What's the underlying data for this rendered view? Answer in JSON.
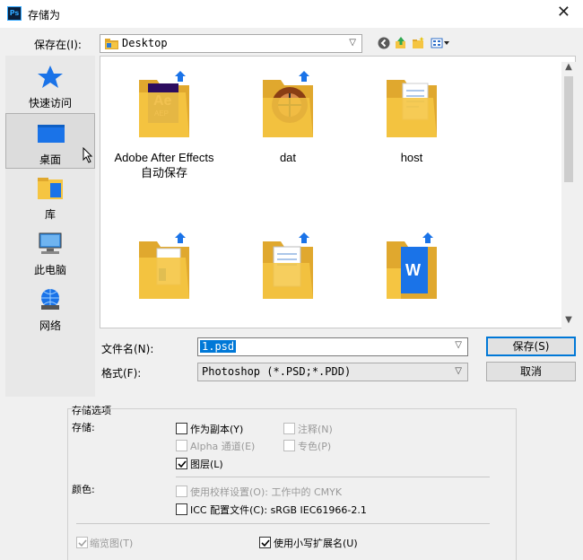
{
  "window": {
    "title": "存储为",
    "close": "✕",
    "app_icon": "Ps"
  },
  "location": {
    "label": "保存在(I):",
    "value": "Desktop"
  },
  "toolbar": {
    "icons": [
      "back-icon",
      "up-folder-icon",
      "new-folder-icon",
      "view-menu-icon"
    ]
  },
  "places": [
    {
      "label": "快速访问",
      "icon": "star-icon"
    },
    {
      "label": "桌面",
      "icon": "desktop-icon",
      "selected": true
    },
    {
      "label": "库",
      "icon": "library-icon"
    },
    {
      "label": "此电脑",
      "icon": "computer-icon"
    },
    {
      "label": "网络",
      "icon": "network-icon"
    }
  ],
  "files": [
    {
      "name": "Adobe After Effects\n自动保存",
      "icon": "ae-folder"
    },
    {
      "name": "dat",
      "icon": "dat-folder"
    },
    {
      "name": "host",
      "icon": "doc-folder"
    },
    {
      "name": "",
      "icon": "plain-folder"
    },
    {
      "name": "",
      "icon": "doc-folder"
    },
    {
      "name": "",
      "icon": "wps-folder"
    }
  ],
  "filename": {
    "label": "文件名(N):",
    "value": "1.psd"
  },
  "format": {
    "label": "格式(F):",
    "value": "Photoshop (*.PSD;*.PDD)"
  },
  "buttons": {
    "save": "保存(S)",
    "cancel": "取消"
  },
  "options": {
    "title": "存储选项",
    "store_label": "存储:",
    "as_copy": "作为副本(Y)",
    "notes": "注释(N)",
    "alpha": "Alpha 通道(E)",
    "spot": "专色(P)",
    "layers": "图层(L)",
    "color_label": "颜色:",
    "proof": "使用校样设置(O):  工作中的 CMYK",
    "icc": "ICC 配置文件(C):  sRGB IEC61966-2.1",
    "thumbnail": "缩览图(T)",
    "lowercase_ext": "使用小写扩展名(U)"
  },
  "colors": {
    "accent": "#0078d7",
    "folder": "#f5c542",
    "folder_dark": "#e0a82e"
  }
}
